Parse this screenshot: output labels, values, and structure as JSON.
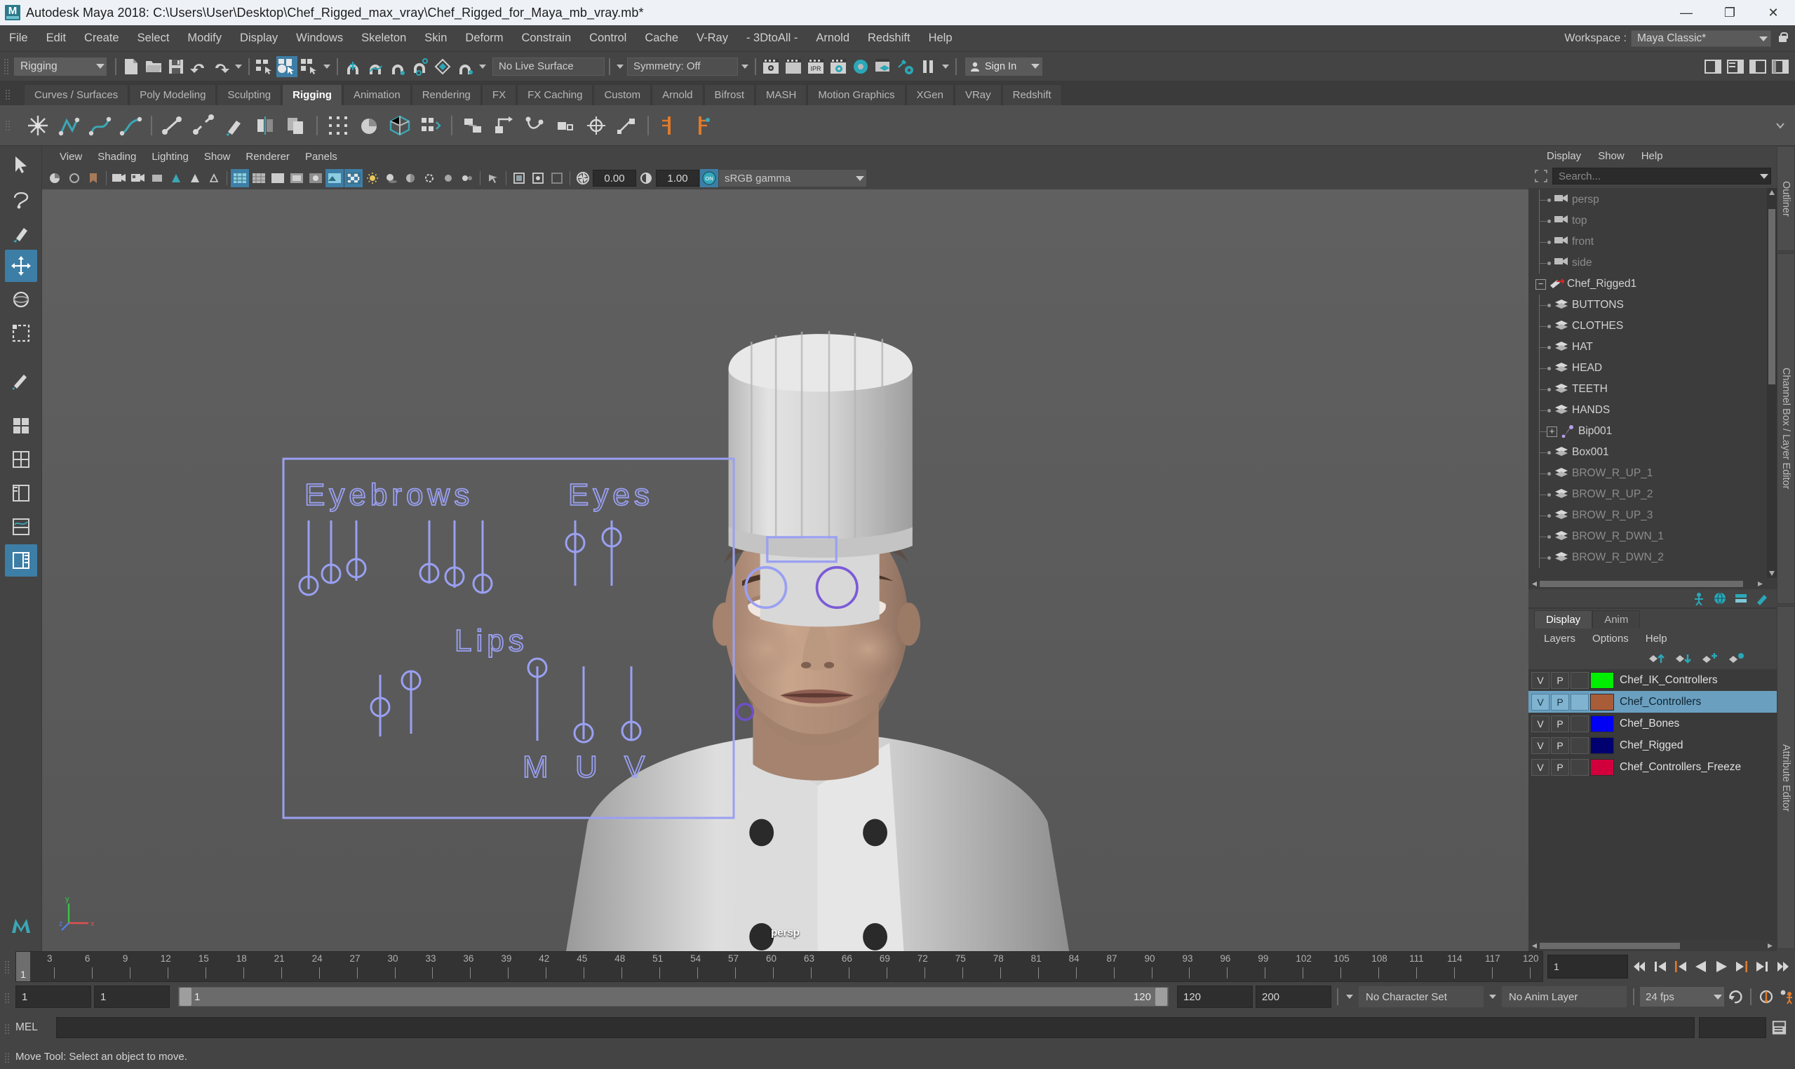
{
  "window": {
    "title": "Autodesk Maya 2018: C:\\Users\\User\\Desktop\\Chef_Rigged_max_vray\\Chef_Rigged_for_Maya_mb_vray.mb*",
    "logo_text": "M",
    "minimize": "—",
    "maximize": "❐",
    "close": "✕"
  },
  "menubar": {
    "items": [
      "File",
      "Edit",
      "Create",
      "Select",
      "Modify",
      "Display",
      "Windows",
      "Skeleton",
      "Skin",
      "Deform",
      "Constrain",
      "Control",
      "Cache",
      "V-Ray",
      "- 3DtoAll -",
      "Arnold",
      "Redshift",
      "Help"
    ],
    "workspace_label": "Workspace :",
    "workspace_value": "Maya Classic*"
  },
  "statusline": {
    "mode": "Rigging",
    "live_surface": "No Live Surface",
    "symmetry": "Symmetry: Off",
    "ipr_label": "IPR",
    "signin": "Sign In"
  },
  "shelf": {
    "tabs": [
      "Curves / Surfaces",
      "Poly Modeling",
      "Sculpting",
      "Rigging",
      "Animation",
      "Rendering",
      "FX",
      "FX Caching",
      "Custom",
      "Arnold",
      "Bifrost",
      "MASH",
      "Motion Graphics",
      "XGen",
      "VRay",
      "Redshift"
    ],
    "active_tab": "Rigging"
  },
  "viewport": {
    "menus": [
      "View",
      "Shading",
      "Lighting",
      "Show",
      "Renderer",
      "Panels"
    ],
    "exposure": "0.00",
    "gamma": "1.00",
    "on_badge": "ON",
    "color_profile": "sRGB gamma",
    "camera_label": "persp",
    "axis_x": "x",
    "axis_y": "y",
    "axis_z": "z",
    "controller_panel": {
      "eyebrows": "Eyebrows",
      "eyes": "Eyes",
      "lips": "Lips",
      "m": "M",
      "u": "U",
      "v": "V"
    }
  },
  "outliner": {
    "panel_tab": "Outliner",
    "menus": [
      "Display",
      "Show",
      "Help"
    ],
    "search_placeholder": "Search...",
    "items": [
      {
        "label": "persp",
        "icon": "camera-icon",
        "depth": 1,
        "dim": true,
        "expander": ""
      },
      {
        "label": "top",
        "icon": "camera-icon",
        "depth": 1,
        "dim": true,
        "expander": ""
      },
      {
        "label": "front",
        "icon": "camera-icon",
        "depth": 1,
        "dim": true,
        "expander": ""
      },
      {
        "label": "side",
        "icon": "camera-icon",
        "depth": 1,
        "dim": true,
        "expander": ""
      },
      {
        "label": "Chef_Rigged1",
        "icon": "transform-icon",
        "depth": 0,
        "dim": false,
        "expander": "−"
      },
      {
        "label": "BUTTONS",
        "icon": "mesh-icon",
        "depth": 1,
        "dim": false,
        "expander": ""
      },
      {
        "label": "CLOTHES",
        "icon": "mesh-icon",
        "depth": 1,
        "dim": false,
        "expander": ""
      },
      {
        "label": "HAT",
        "icon": "mesh-icon",
        "depth": 1,
        "dim": false,
        "expander": ""
      },
      {
        "label": "HEAD",
        "icon": "mesh-icon",
        "depth": 1,
        "dim": false,
        "expander": ""
      },
      {
        "label": "TEETH",
        "icon": "mesh-icon",
        "depth": 1,
        "dim": false,
        "expander": ""
      },
      {
        "label": "HANDS",
        "icon": "mesh-icon",
        "depth": 1,
        "dim": false,
        "expander": ""
      },
      {
        "label": "Bip001",
        "icon": "joint-icon",
        "depth": 1,
        "dim": false,
        "expander": "+"
      },
      {
        "label": "Box001",
        "icon": "mesh-icon",
        "depth": 1,
        "dim": false,
        "expander": ""
      },
      {
        "label": "BROW_R_UP_1",
        "icon": "mesh-icon",
        "depth": 1,
        "dim": true,
        "expander": ""
      },
      {
        "label": "BROW_R_UP_2",
        "icon": "mesh-icon",
        "depth": 1,
        "dim": true,
        "expander": ""
      },
      {
        "label": "BROW_R_UP_3",
        "icon": "mesh-icon",
        "depth": 1,
        "dim": true,
        "expander": ""
      },
      {
        "label": "BROW_R_DWN_1",
        "icon": "mesh-icon",
        "depth": 1,
        "dim": true,
        "expander": ""
      },
      {
        "label": "BROW_R_DWN_2",
        "icon": "mesh-icon",
        "depth": 1,
        "dim": true,
        "expander": ""
      }
    ]
  },
  "layer_editor": {
    "panel_tabs": [
      "Channel Box / Layer Editor",
      "Attribute Editor"
    ],
    "tabs": [
      "Display",
      "Anim"
    ],
    "active_tab": "Display",
    "menus": [
      "Layers",
      "Options",
      "Help"
    ],
    "col_v": "V",
    "col_p": "P",
    "rows": [
      {
        "v": "V",
        "p": "P",
        "color": "#00ee00",
        "name": "Chef_IK_Controllers",
        "selected": false
      },
      {
        "v": "V",
        "p": "P",
        "color": "#a85d38",
        "name": "Chef_Controllers",
        "selected": true
      },
      {
        "v": "V",
        "p": "P",
        "color": "#0000f5",
        "name": "Chef_Bones",
        "selected": false
      },
      {
        "v": "V",
        "p": "P",
        "color": "#000070",
        "name": "Chef_Rigged",
        "selected": false
      },
      {
        "v": "V",
        "p": "P",
        "color": "#d1003c",
        "name": "Chef_Controllers_Freeze",
        "selected": false
      }
    ]
  },
  "timeline": {
    "ticks": [
      "3",
      "6",
      "9",
      "12",
      "15",
      "18",
      "21",
      "24",
      "27",
      "30",
      "33",
      "36",
      "39",
      "42",
      "45",
      "48",
      "51",
      "54",
      "57",
      "60",
      "63",
      "66",
      "69",
      "72",
      "75",
      "78",
      "81",
      "84",
      "87",
      "90",
      "93",
      "96",
      "99",
      "102",
      "105",
      "108",
      "111",
      "114",
      "117",
      "120"
    ],
    "current_frame_marker": "1",
    "current_frame_field": "1"
  },
  "range": {
    "anim_start": "1",
    "range_start": "1",
    "slider_start": "1",
    "slider_end": "120",
    "range_end": "120",
    "anim_end": "200",
    "character_set": "No Character Set",
    "anim_layer": "No Anim Layer",
    "fps": "24 fps"
  },
  "command": {
    "mel_label": "MEL",
    "mel_value": "",
    "status_text": "Move Tool: Select an object to move."
  }
}
